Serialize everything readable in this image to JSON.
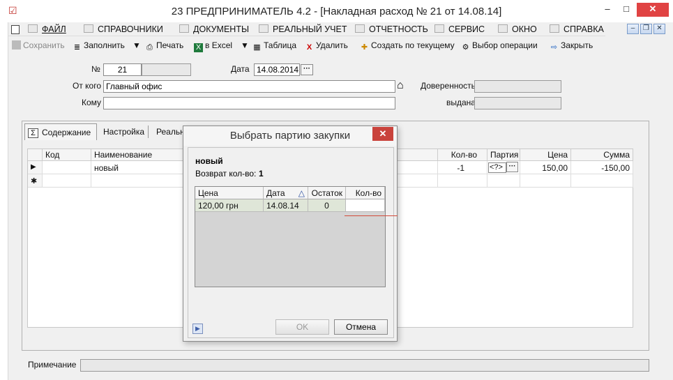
{
  "window": {
    "title": "23  ПРЕДПРИНИМАТЕЛЬ 4.2 - [Накладная расход № 21 от 14.08.14]",
    "minimize_glyph": "–",
    "maximize_glyph": "□",
    "close_glyph": "✕"
  },
  "menu": {
    "items": [
      "ФАЙЛ",
      "СПРАВОЧНИКИ",
      "ДОКУМЕНТЫ",
      "РЕАЛЬНЫЙ УЧЕТ",
      "ОТЧЕТНОСТЬ",
      "СЕРВИС",
      "ОКНО",
      "СПРАВКА"
    ],
    "mdi_buttons": [
      "–",
      "❐",
      "✕"
    ]
  },
  "toolbar": {
    "save": "Сохранить",
    "fill": "Заполнить",
    "print": "Печать",
    "excel": "в Excel",
    "table": "Таблица",
    "delete": "Удалить",
    "create_from_current": "Создать по текущему",
    "select_operation": "Выбор операции",
    "close": "Закрыть"
  },
  "form": {
    "number_label": "№",
    "number_value": "21",
    "number_extra": "",
    "date_label": "Дата",
    "date_value": "14.08.2014",
    "from_label": "От кого",
    "from_value": "Главный офис",
    "to_label": "Кому",
    "to_value": "",
    "proxy_label": "Доверенность",
    "proxy_value": "",
    "issued_label": "выдана",
    "issued_value": ""
  },
  "tabs": [
    "Содержание",
    "Настройка",
    "Реальн"
  ],
  "grid": {
    "headers": {
      "code": "Код",
      "name": "Наименование",
      "qty": "Кол-во",
      "batch": "Партия",
      "price": "Цена",
      "sum": "Сумма"
    },
    "rows": [
      {
        "marker": "▶",
        "code": "",
        "name": "новый",
        "qty": "-1",
        "batch": "<?>",
        "price": "150,00",
        "sum": "-150,00"
      },
      {
        "marker": "✱",
        "code": "",
        "name": "",
        "qty": "",
        "batch": "",
        "price": "",
        "sum": ""
      }
    ]
  },
  "note": {
    "label": "Примечание",
    "value": ""
  },
  "dialog": {
    "title": "Выбрать партию закупки",
    "close_glyph": "✕",
    "item_name": "новый",
    "return_label": "Возврат кол-во:",
    "return_value": "1",
    "headers": {
      "price": "Цена",
      "date": "Дата",
      "sort_glyph": "△",
      "remainder": "Остаток",
      "qty": "Кол-во"
    },
    "rows": [
      {
        "price": "120,00 грн",
        "date": "14.08.14",
        "remainder": "0",
        "qty": ""
      }
    ],
    "ok": "OK",
    "cancel": "Отмена",
    "nav_glyph": "▶"
  },
  "colors": {
    "accent_red": "#c9433c",
    "row_selected": "#dfe6d8",
    "dialog_bg": "#f0f0f0"
  }
}
